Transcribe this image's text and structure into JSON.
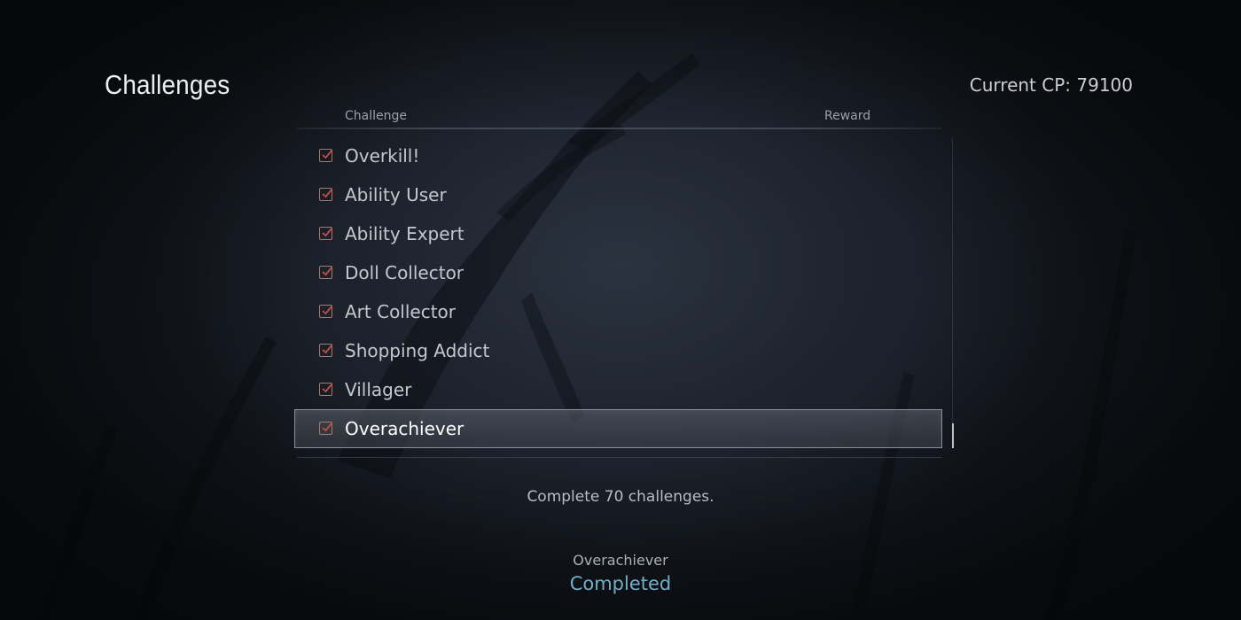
{
  "header": {
    "title": "Challenges",
    "current_cp": "Current CP: 79100"
  },
  "columns": {
    "challenge": "Challenge",
    "reward": "Reward"
  },
  "challenges": [
    {
      "label": "Overkill!",
      "checked": true
    },
    {
      "label": "Ability User",
      "checked": true
    },
    {
      "label": "Ability Expert",
      "checked": true
    },
    {
      "label": "Doll Collector",
      "checked": true
    },
    {
      "label": "Art Collector",
      "checked": true
    },
    {
      "label": "Shopping Addict",
      "checked": true
    },
    {
      "label": "Villager",
      "checked": true
    },
    {
      "label": "Overachiever",
      "checked": true,
      "selected": true
    }
  ],
  "detail": {
    "description": "Complete 70 challenges.",
    "name": "Overachiever",
    "status": "Completed"
  },
  "colors": {
    "checkbox_border": "#9d7d78",
    "checkmark": "#c0504a",
    "status": "#74aec4"
  }
}
